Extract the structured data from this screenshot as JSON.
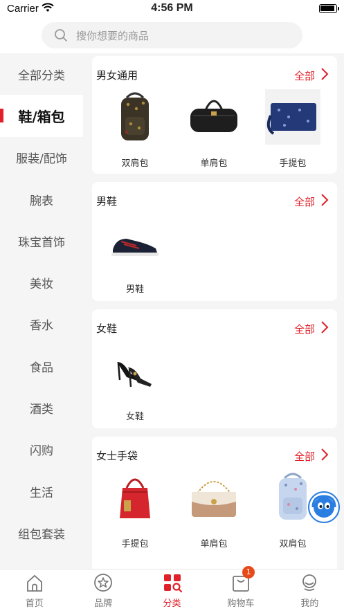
{
  "status": {
    "carrier": "Carrier",
    "time": "4:56 PM"
  },
  "search": {
    "placeholder": "搜你想要的商品"
  },
  "sidebar": {
    "items": [
      {
        "label": "全部分类"
      },
      {
        "label": "鞋/箱包"
      },
      {
        "label": "服装/配饰"
      },
      {
        "label": "腕表"
      },
      {
        "label": "珠宝首饰"
      },
      {
        "label": "美妆"
      },
      {
        "label": "香水"
      },
      {
        "label": "食品"
      },
      {
        "label": "酒类"
      },
      {
        "label": "闪购"
      },
      {
        "label": "生活"
      },
      {
        "label": "组包套装"
      }
    ],
    "active_index": 1
  },
  "sections": [
    {
      "title": "男女通用",
      "all_label": "全部",
      "products": [
        {
          "label": "双肩包",
          "icon": "backpack-dark"
        },
        {
          "label": "单肩包",
          "icon": "duffel-bag"
        },
        {
          "label": "手提包",
          "icon": "clutch-navy"
        }
      ]
    },
    {
      "title": "男鞋",
      "all_label": "全部",
      "products": [
        {
          "label": "男鞋",
          "icon": "sneaker"
        }
      ]
    },
    {
      "title": "女鞋",
      "all_label": "全部",
      "products": [
        {
          "label": "女鞋",
          "icon": "heels"
        }
      ]
    },
    {
      "title": "女士手袋",
      "all_label": "全部",
      "products": [
        {
          "label": "手提包",
          "icon": "bucket-bag-red"
        },
        {
          "label": "单肩包",
          "icon": "shoulder-bag-tan"
        },
        {
          "label": "双肩包",
          "icon": "backpack-light"
        }
      ]
    }
  ],
  "tabbar": {
    "tabs": [
      {
        "label": "首页",
        "icon": "home-icon"
      },
      {
        "label": "品牌",
        "icon": "brand-star-icon"
      },
      {
        "label": "分类",
        "icon": "category-grid-icon"
      },
      {
        "label": "购物车",
        "icon": "cart-bag-icon"
      },
      {
        "label": "我的",
        "icon": "profile-icon"
      }
    ],
    "active_index": 2,
    "cart_badge": "1"
  },
  "colors": {
    "accent": "#e0202a",
    "sidebar_bg": "#f5f5f5",
    "badge": "#e64a19"
  }
}
